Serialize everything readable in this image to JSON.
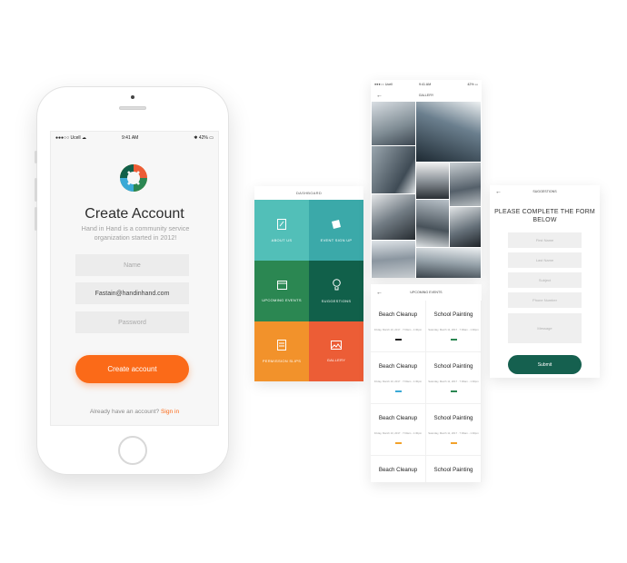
{
  "phone": {
    "status": {
      "carrier": "●●●○○ Ucell ☁",
      "time": "9:41 AM",
      "battery": "✱ 42% ▭"
    },
    "title": "Create Account",
    "subtitle": "Hand in Hand is a community service organization started in 2012!",
    "fields": {
      "name_placeholder": "Name",
      "email_value": "Fastain@handinhand.com",
      "password_placeholder": "Password"
    },
    "cta_label": "Create account",
    "signin_prompt": "Already have an account?",
    "signin_link": "Sign in"
  },
  "dashboard": {
    "title": "DASHBOARD",
    "tiles": [
      {
        "label": "ABOUT US",
        "icon": "document-icon"
      },
      {
        "label": "EVENT SIGN UP",
        "icon": "ticket-icon"
      },
      {
        "label": "UPCOMING EVENTS",
        "icon": "calendar-icon"
      },
      {
        "label": "SUGGESTIONS",
        "icon": "lightbulb-icon"
      },
      {
        "label": "PERMISSION SLIPS",
        "icon": "slip-icon"
      },
      {
        "label": "GALLERY",
        "icon": "image-icon"
      }
    ],
    "colors": [
      "#52bfb8",
      "#3ba9a9",
      "#2b8752",
      "#11604a",
      "#f2922b",
      "#ec5d36"
    ]
  },
  "gallery": {
    "status": {
      "carrier": "●●●○○ Ucell",
      "time": "9:41 AM",
      "battery": "42% ▭"
    },
    "title": "GALLERY"
  },
  "events": {
    "title": "UPCOMING EVENTS",
    "items": [
      {
        "name": "Beach Cleanup",
        "date": "Friday, March 10, 2017 · 7:00am - 1:30pm",
        "color": "#222222"
      },
      {
        "name": "School Painting",
        "date": "Saturday, March 11, 2017 · 7:00am - 1:30pm",
        "color": "#2b8752"
      },
      {
        "name": "Beach Cleanup",
        "date": "Friday, March 10, 2017 · 7:00am - 1:30pm",
        "color": "#3ba9d6"
      },
      {
        "name": "School Painting",
        "date": "Saturday, March 11, 2017 · 7:00am - 1:30pm",
        "color": "#2b8752"
      },
      {
        "name": "Beach Cleanup",
        "date": "Friday, March 10, 2017 · 7:00am - 1:30pm",
        "color": "#f2a22b"
      },
      {
        "name": "School Painting",
        "date": "Saturday, March 11, 2017 · 7:00am - 1:30pm",
        "color": "#f2a22b"
      },
      {
        "name": "Beach Cleanup",
        "date": "",
        "color": ""
      },
      {
        "name": "School Painting",
        "date": "",
        "color": ""
      }
    ]
  },
  "suggestions": {
    "title": "SUGGESTIONS",
    "heading": "PLEASE COMPLETE THE FORM BELOW",
    "fields": [
      "First Name",
      "Last Name",
      "Subject",
      "Phone Number",
      "Message"
    ],
    "submit_label": "Submit"
  }
}
